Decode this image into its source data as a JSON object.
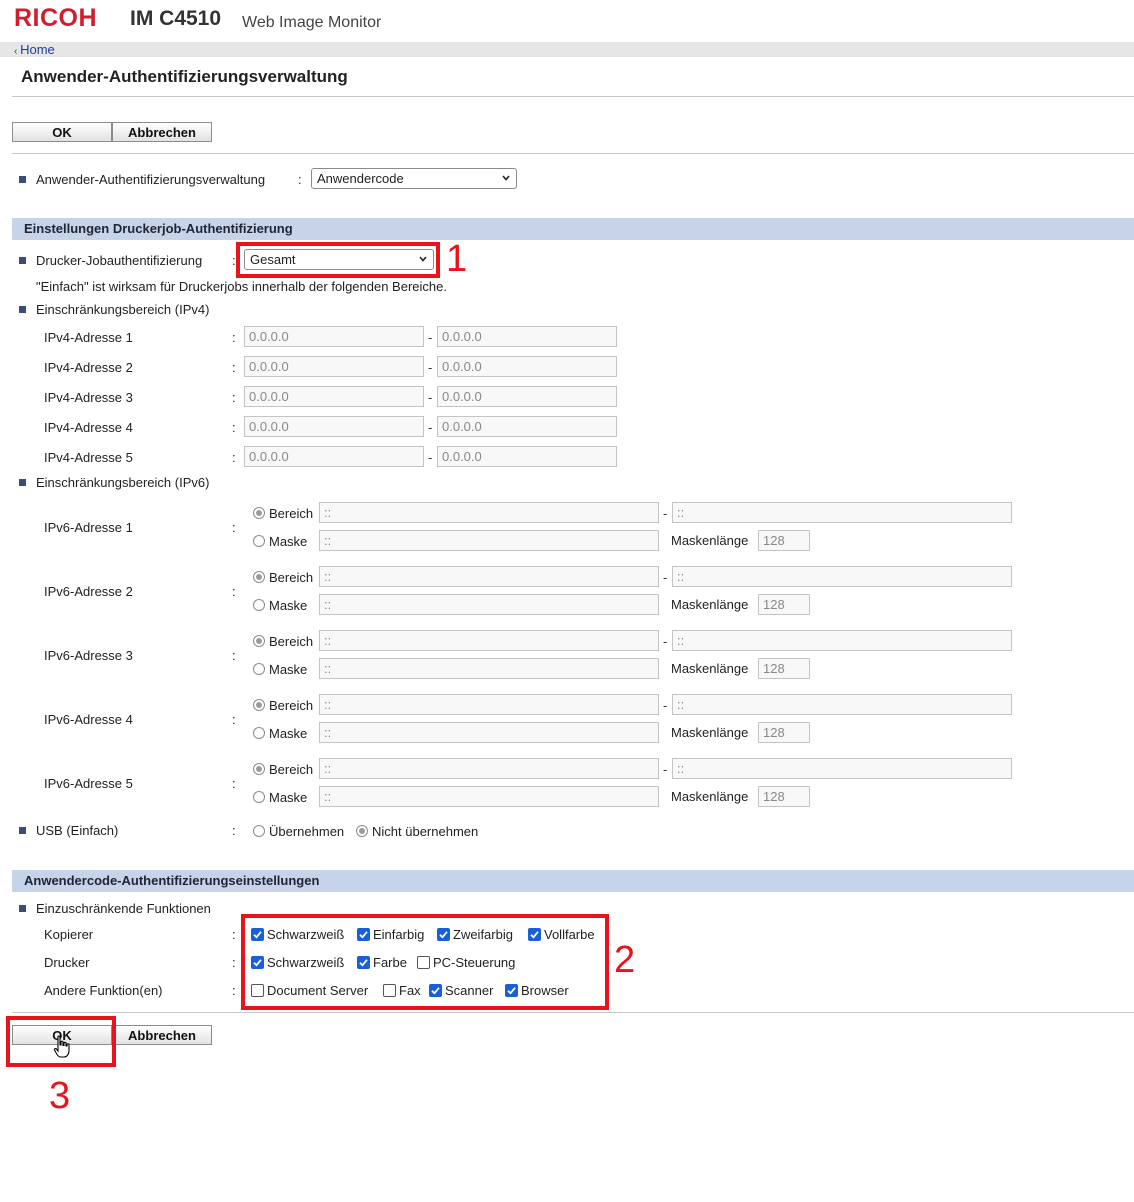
{
  "header": {
    "brand": "RICOH",
    "model": "IM C4510",
    "app_name": "Web Image Monitor",
    "home_link": "Home"
  },
  "page_title": "Anwender-Authentifizierungsverwaltung",
  "buttons": {
    "ok": "OK",
    "cancel": "Abbrechen"
  },
  "auth_management": {
    "label": "Anwender-Authentifizierungsverwaltung",
    "colon": ":",
    "selected": "Anwendercode"
  },
  "printer_section": {
    "title": "Einstellungen Druckerjob-Authentifizierung",
    "job_auth_label": "Drucker-Jobauthentifizierung",
    "job_auth_selected": "Gesamt",
    "note": "\"Einfach\" ist wirksam für Druckerjobs innerhalb der folgenden Bereiche.",
    "ipv4_heading": "Einschränkungsbereich (IPv4)",
    "ipv4_rows": [
      {
        "label": "IPv4-Adresse 1",
        "from": "0.0.0.0",
        "to": "0.0.0.0"
      },
      {
        "label": "IPv4-Adresse 2",
        "from": "0.0.0.0",
        "to": "0.0.0.0"
      },
      {
        "label": "IPv4-Adresse 3",
        "from": "0.0.0.0",
        "to": "0.0.0.0"
      },
      {
        "label": "IPv4-Adresse 4",
        "from": "0.0.0.0",
        "to": "0.0.0.0"
      },
      {
        "label": "IPv4-Adresse 5",
        "from": "0.0.0.0",
        "to": "0.0.0.0"
      }
    ],
    "ipv6_heading": "Einschränkungsbereich (IPv6)",
    "ipv6_range_label": "Bereich",
    "ipv6_mask_label": "Maske",
    "ipv6_masklen_label": "Maskenlänge",
    "ipv6_rows": [
      {
        "label": "IPv6-Adresse 1",
        "from": "::",
        "to": "::",
        "mask": "::",
        "masklen": "128"
      },
      {
        "label": "IPv6-Adresse 2",
        "from": "::",
        "to": "::",
        "mask": "::",
        "masklen": "128"
      },
      {
        "label": "IPv6-Adresse 3",
        "from": "::",
        "to": "::",
        "mask": "::",
        "masklen": "128"
      },
      {
        "label": "IPv6-Adresse 4",
        "from": "::",
        "to": "::",
        "mask": "::",
        "masklen": "128"
      },
      {
        "label": "IPv6-Adresse 5",
        "from": "::",
        "to": "::",
        "mask": "::",
        "masklen": "128"
      }
    ],
    "usb_label": "USB (Einfach)",
    "usb_options": [
      "Übernehmen",
      "Nicht übernehmen"
    ],
    "usb_selected": "Nicht übernehmen"
  },
  "usercode_section": {
    "title": "Anwendercode-Authentifizierungseinstellungen",
    "restricted_heading": "Einzuschränkende Funktionen",
    "rows": [
      {
        "label": "Kopierer",
        "items": [
          {
            "text": "Schwarzweiß",
            "checked": true
          },
          {
            "text": "Einfarbig",
            "checked": true
          },
          {
            "text": "Zweifarbig",
            "checked": true
          },
          {
            "text": "Vollfarbe",
            "checked": true
          }
        ]
      },
      {
        "label": "Drucker",
        "items": [
          {
            "text": "Schwarzweiß",
            "checked": true
          },
          {
            "text": "Farbe",
            "checked": true
          },
          {
            "text": "PC-Steuerung",
            "checked": false
          }
        ]
      },
      {
        "label": "Andere Funktion(en)",
        "items": [
          {
            "text": "Document Server",
            "checked": false
          },
          {
            "text": "Fax",
            "checked": false
          },
          {
            "text": "Scanner",
            "checked": true
          },
          {
            "text": "Browser",
            "checked": true
          }
        ]
      }
    ]
  },
  "annotations": {
    "marker1": "1",
    "marker2": "2",
    "marker3": "3"
  },
  "colors": {
    "brand_red": "#cf1f2e",
    "section_blue": "#c6d3e8",
    "annotation_red": "#e8131b",
    "checkbox_blue": "#1a5fd8"
  }
}
